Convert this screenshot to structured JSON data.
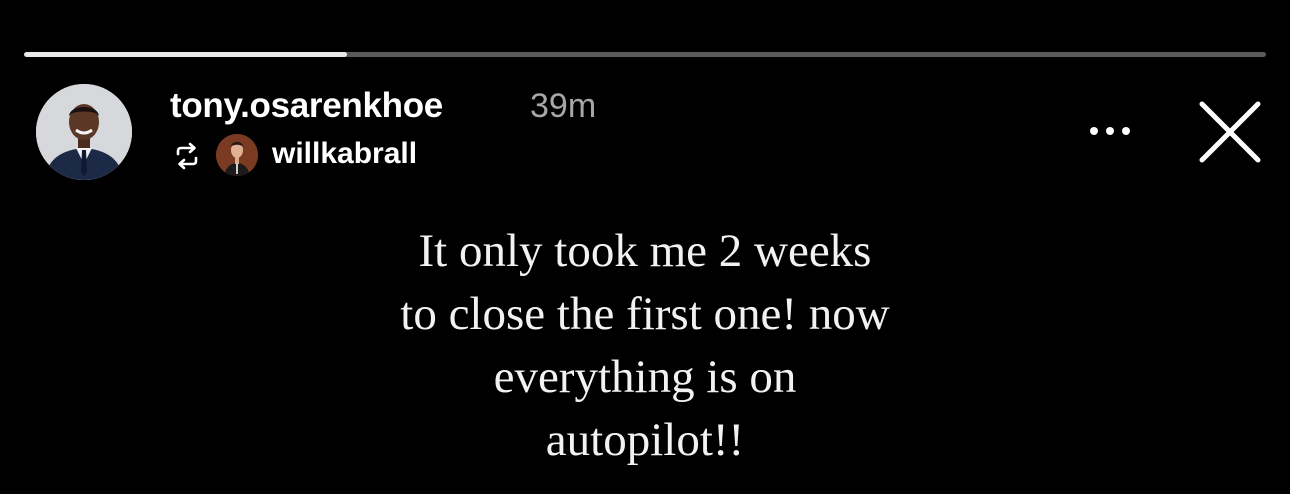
{
  "progress": {
    "fraction": 0.26
  },
  "header": {
    "username": "tony.osarenkhoe",
    "timestamp": "39m",
    "reposted_from": "willkabrall",
    "repost_icon": "repost-icon",
    "more_icon": "more-icon",
    "close_icon": "close-icon"
  },
  "story": {
    "lines": [
      "It only took me 2 weeks",
      "to close the first one! now",
      "everything is on",
      "autopilot!!"
    ]
  },
  "colors": {
    "background": "#000000",
    "text": "#ffffff",
    "muted": "#a7a7a7",
    "progress_track": "#5a5a5a",
    "progress_fill": "#e9e9e9"
  }
}
